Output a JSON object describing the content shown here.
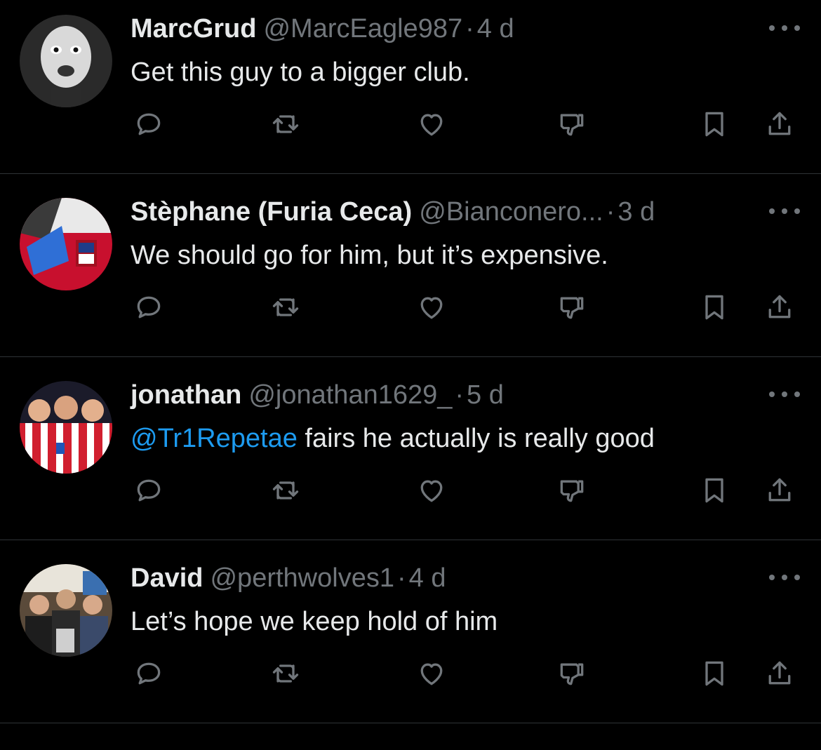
{
  "colors": {
    "background": "#000000",
    "primary_text": "#e7e9ea",
    "secondary_text": "#71767b",
    "mention": "#1d9bf0",
    "divider": "#2f3336"
  },
  "icons": {
    "reply": "reply-bubble-icon",
    "retweet": "retweet-icon",
    "like": "heart-icon",
    "dislike": "thumbs-down-icon",
    "bookmark": "bookmark-icon",
    "share": "share-icon",
    "more": "more-options-icon"
  },
  "replies": [
    {
      "display_name": "MarcGrud",
      "handle": "@MarcEagle987",
      "separator": "·",
      "time": "4 d",
      "mention": "",
      "text": "Get this guy to a bigger club."
    },
    {
      "display_name": "Stèphane (Furia Ceca)",
      "handle": "@Bianconero...",
      "separator": "·",
      "time": "3 d",
      "mention": "",
      "text": "We should go for him, but it’s expensive."
    },
    {
      "display_name": "jonathan",
      "handle": "@jonathan1629_",
      "separator": "·",
      "time": "5 d",
      "mention": "@Tr1Repetae",
      "text": " fairs he actually is really good"
    },
    {
      "display_name": "David",
      "handle": "@perthwolves1",
      "separator": "·",
      "time": "4 d",
      "mention": "",
      "text": "Let’s hope we keep hold of him"
    }
  ]
}
